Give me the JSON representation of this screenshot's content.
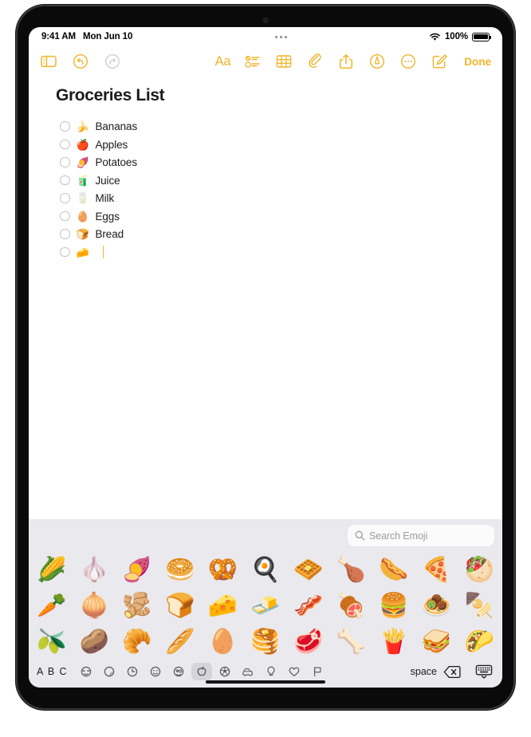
{
  "status_bar": {
    "time": "9:41 AM",
    "date": "Mon Jun 10",
    "battery_percent": "100%",
    "wifi_icon": "wifi-icon",
    "battery_icon": "battery-icon"
  },
  "toolbar": {
    "sidebar_icon": "sidebar-toggle-icon",
    "undo_icon": "undo-icon",
    "redo_icon": "redo-icon",
    "format_label": "Aa",
    "checklist_icon": "checklist-icon",
    "table_icon": "table-icon",
    "attachment_icon": "paperclip-icon",
    "share_icon": "share-icon",
    "markup_icon": "markup-pen-icon",
    "more_icon": "more-ellipsis-icon",
    "compose_icon": "compose-icon",
    "done_label": "Done"
  },
  "note": {
    "title": "Groceries List",
    "items": [
      {
        "emoji": "🍌",
        "label": "Bananas",
        "checked": false
      },
      {
        "emoji": "🍎",
        "label": "Apples",
        "checked": false
      },
      {
        "emoji": "🍠",
        "label": "Potatoes",
        "checked": false
      },
      {
        "emoji": "🧃",
        "label": "Juice",
        "checked": false
      },
      {
        "emoji": "🥛",
        "label": "Milk",
        "checked": false
      },
      {
        "emoji": "🥚",
        "label": "Eggs",
        "checked": false
      },
      {
        "emoji": "🍞",
        "label": "Bread",
        "checked": false
      },
      {
        "emoji": "🧀",
        "label": "",
        "checked": false,
        "cursor": true
      }
    ]
  },
  "keyboard": {
    "search": {
      "placeholder": "Search Emoji",
      "icon": "search-icon"
    },
    "emoji_rows": [
      [
        "🌽",
        "🧄",
        "🍠",
        "🥯",
        "🥨",
        "🍳",
        "🧇",
        "🍗",
        "🌭",
        "🍕",
        "🥙"
      ],
      [
        "🥕",
        "🧅",
        "🫚",
        "🍞",
        "🧀",
        "🧈",
        "🥓",
        "🍖",
        "🍔",
        "🧆",
        "🍢"
      ],
      [
        "🫒",
        "🥔",
        "🥐",
        "🥖",
        "🥚",
        "🥞",
        "🥩",
        "🦴",
        "🍟",
        "🥪",
        "🌮"
      ]
    ],
    "abc_label": "A B C",
    "space_label": "space",
    "delete_icon": "delete-backspace-icon",
    "hide_keyboard_icon": "hide-keyboard-icon",
    "categories": [
      {
        "name": "memoji-sticker-icon",
        "active": false
      },
      {
        "name": "stickers-icon",
        "active": false
      },
      {
        "name": "recents-clock-icon",
        "active": false
      },
      {
        "name": "smileys-icon",
        "active": false
      },
      {
        "name": "people-icon",
        "active": false
      },
      {
        "name": "food-drink-icon",
        "active": true
      },
      {
        "name": "activity-icon",
        "active": false
      },
      {
        "name": "travel-places-icon",
        "active": false
      },
      {
        "name": "objects-icon",
        "active": false
      },
      {
        "name": "symbols-icon",
        "active": false
      },
      {
        "name": "flags-icon",
        "active": false
      }
    ]
  },
  "colors": {
    "accent": "#f0b429",
    "keyboard_bg": "#e9e9ee",
    "text": "#1b1b1d"
  }
}
